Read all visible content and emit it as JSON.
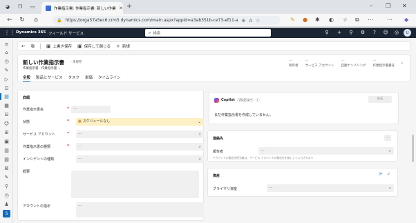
{
  "browser": {
    "tab_title": "作業指示書: 作業指示書: 新しい作業指示書",
    "url": "https://orga57a5ec6.crm5.dynamics.com/main.aspx?appid=a3ab351b-ce73-ef11-a66f-000d3aa15904..."
  },
  "app": {
    "brand": "Dynamics 365",
    "name": "フィールド サービス",
    "search_placeholder": "検索",
    "avatar": "U"
  },
  "commands": {
    "save_close": "上書き保存",
    "save_close2": "保存して閉じる",
    "new": "新規"
  },
  "record": {
    "title": "新しい作業指示書",
    "status": "- 未保存",
    "sub_label1": "作業指示書",
    "sub_label2": "作業指示書",
    "header_fields": [
      {
        "dash": "---",
        "label": "所有者"
      },
      {
        "dash": "---",
        "label": "サービス アカウント"
      },
      {
        "dash": "---",
        "label": "自動ナンバリング"
      },
      {
        "dash": "---",
        "label": "作業指示書番号"
      }
    ],
    "tabs": [
      "全般",
      "製品とサービス",
      "タスク",
      "単価",
      "タイムライン"
    ]
  },
  "form": {
    "section_title": "詳細",
    "fields": [
      {
        "label": "作業指示書名",
        "value": "---",
        "required": true
      },
      {
        "label": "状態",
        "value": "スケジュールなし",
        "required": true
      },
      {
        "label": "サービス アカウント",
        "value": "---",
        "required": true
      },
      {
        "label": "作業指示書の種類",
        "value": "---",
        "required": true
      },
      {
        "label": "インシデントの種類",
        "value": "---",
        "required": false
      },
      {
        "label": "概要",
        "value": "",
        "required": false
      },
      {
        "label": "アカウントの指示",
        "value": "---",
        "required": false
      }
    ]
  },
  "copilot": {
    "name": "Copilot",
    "badge": "プレビュー",
    "info": "ⓘ",
    "button": "生成",
    "message": "まだ作業指示書を作成していません。"
  },
  "contact": {
    "title": "連絡先",
    "reporter_label": "報告者",
    "reporter_value": "---",
    "hint": "アカウントの報告先担当者は、サービス アカウントの報告先を基にして入力されます"
  },
  "asset": {
    "title": "資産",
    "primary_label": "プライマリ資産",
    "primary_value": "---"
  }
}
